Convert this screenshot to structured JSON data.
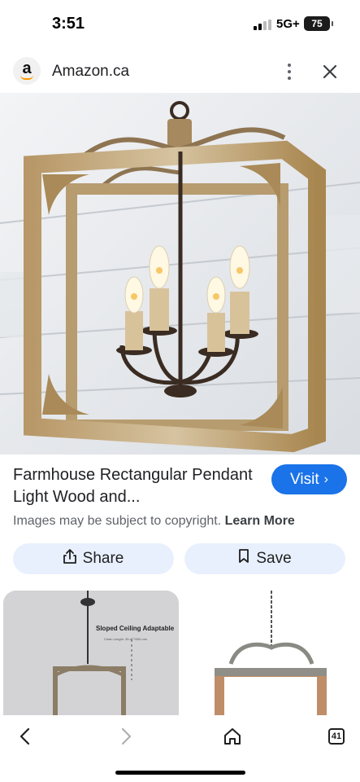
{
  "status_bar": {
    "time": "3:51",
    "network": "5G+",
    "battery": "75"
  },
  "source": {
    "logo_letter": "a",
    "name": "Amazon.ca"
  },
  "product": {
    "title": "Farmhouse Rectangular Pendant Light Wood and...",
    "visit_label": "Visit",
    "visit_chevron": "›"
  },
  "copyright": {
    "text": "Images may be subject to copyright.",
    "link": "Learn More"
  },
  "actions": {
    "share_label": "Share",
    "save_label": "Save"
  },
  "related": {
    "card1_heading": "Sloped Ceiling Adaptable",
    "card1_sub": "Chain Length: 35.47\"/900 mm"
  },
  "bottom_nav": {
    "tabs_count": "41"
  },
  "colors": {
    "accent": "#1a73e8",
    "chip_bg": "#e8f0fe"
  },
  "icons": [
    "amazon-logo",
    "more-vert-icon",
    "close-icon",
    "share-icon",
    "bookmark-icon",
    "back-icon",
    "forward-icon",
    "home-icon",
    "tabs-icon"
  ]
}
